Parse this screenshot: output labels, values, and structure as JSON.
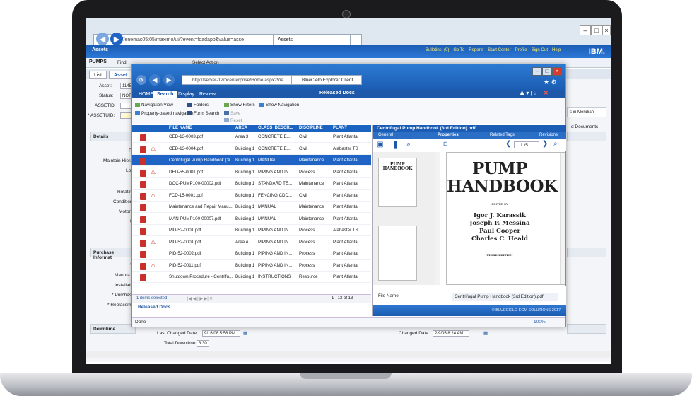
{
  "outer_browser": {
    "url": "http://enemas05:05/maximo/ui/?event=loadapp&value=asse",
    "tab": "Assets",
    "app_label": "Assets",
    "links": [
      "Bulletins: (0)",
      "Go To",
      "Reports",
      "Start Center",
      "Profile",
      "Sign Out",
      "Help"
    ],
    "brand": "IBM."
  },
  "maximo": {
    "record": "PUMPS",
    "find_label": "Find:",
    "select_action": "Select Action",
    "tabs": [
      "List",
      "Asset"
    ],
    "fields": {
      "asset_label": "Asset:",
      "asset_value": "11450",
      "status_label": "Status:",
      "status_value": "NOT R",
      "assetid_label": "ASSETID:",
      "assetuid_label": "* ASSETUID:"
    },
    "sections": [
      "Details",
      "Purchase Informat",
      "Downtime"
    ],
    "detail_labels": [
      "P",
      "Maintain Hiera",
      "Loc",
      "Rotating",
      "Condition",
      "Motor C",
      "U"
    ],
    "purchase_labels": [
      "V",
      "Manufa",
      "Installatio",
      "* Purchase",
      "* Replacemer"
    ],
    "right_labels": [
      "s in Meridian",
      "d Documents"
    ],
    "last_changed_label": "Last Changed Date:",
    "last_changed_value": "9/16/08 5:58 PM",
    "total_downtime_label": "Total Downtime:",
    "total_downtime_value": "3:30",
    "changed_label": "Changed Date:",
    "changed_value": "2/9/05 8:24 AM"
  },
  "inner_browser": {
    "url": "http://server-12/bcenterprise/Home.aspx?Vie",
    "tab": "BlueCielo Explorer Client"
  },
  "ribbon": {
    "tabs": [
      "HOME",
      "Search",
      "Display",
      "Review"
    ],
    "title": "Released Docs",
    "buttons": {
      "navigation_view": "Navigation View",
      "property_nav": "Property-based navigation",
      "folders": "Folders",
      "form_search": "Form Search",
      "show_filters": "Show Filters",
      "save": "Save",
      "reset": "Reset",
      "show_navigation": "Show Navigation"
    }
  },
  "grid": {
    "columns": [
      "FILE NAME",
      "AREA",
      "CLASS_DESCR...",
      "DISCIPLINE",
      "PLANT"
    ],
    "rows": [
      {
        "file": "CED-13-0003.pdf",
        "area": "Area 3",
        "class": "CONCRETE E...",
        "disc": "Civil",
        "plant": "Plant Atlanta"
      },
      {
        "file": "CED-13-0004.pdf",
        "area": "Building 1",
        "class": "CONCRETE E...",
        "disc": "Civil",
        "plant": "Alabaster TS"
      },
      {
        "file": "Centrifugal Pump Handbook (3r...",
        "area": "Building 1",
        "class": "MANUAL",
        "disc": "Maintenance",
        "plant": "Plant Atlanta"
      },
      {
        "file": "DED-55-0001.pdf",
        "area": "Building 1",
        "class": "PIPING AND IN...",
        "disc": "Process",
        "plant": "Plant Atlanta"
      },
      {
        "file": "DOC-PUMP100-00002.pdf",
        "area": "Building 1",
        "class": "STANDARD TE...",
        "disc": "Maintenance",
        "plant": "Plant Atlanta"
      },
      {
        "file": "FCD-15-0001.pdf",
        "area": "Building 1",
        "class": "FENCING CDD...",
        "disc": "Civil",
        "plant": "Plant Atlanta"
      },
      {
        "file": "Maintenance and Repair Manu...",
        "area": "Building 1",
        "class": "MANUAL",
        "disc": "Maintenance",
        "plant": "Plant Atlanta"
      },
      {
        "file": "MAN-PUMP100-00007.pdf",
        "area": "Building 1",
        "class": "MANUAL",
        "disc": "Maintenance",
        "plant": "Plant Atlanta"
      },
      {
        "file": "PID-52-0001.pdf",
        "area": "Building 1",
        "class": "PIPING AND IN...",
        "disc": "Process",
        "plant": "Alabaster TS"
      },
      {
        "file": "PID-52-0001.pdf",
        "area": "Area A",
        "class": "PIPING AND IN...",
        "disc": "Process",
        "plant": "Plant Atlanta"
      },
      {
        "file": "PID-52-0002.pdf",
        "area": "Building 1",
        "class": "PIPING AND IN...",
        "disc": "Process",
        "plant": "Plant Atlanta"
      },
      {
        "file": "PID-52-0011.pdf",
        "area": "Building 1",
        "class": "PIPING AND IN...",
        "disc": "Process",
        "plant": "Plant Atlanta"
      },
      {
        "file": "Shutdown Procedure - Centrifu...",
        "area": "Building 1",
        "class": "INSTRUCTIONS",
        "disc": "Resource",
        "plant": "Plant Atlanta"
      }
    ],
    "selected_index": 2,
    "items_selected": "1 items selected",
    "count": "1 - 13 of 13",
    "released_tab": "Released Docs",
    "status": "Done",
    "zoom": "100%"
  },
  "viewer": {
    "title": "Centrifugal Pump Handbook (3rd Edition).pdf",
    "tabs": [
      "General",
      "Properties",
      "Related Tags",
      "Revisions"
    ],
    "page_value": "1",
    "page_total": "/5",
    "book_title": "PUMP HANDBOOK",
    "edited_by": "EDITED BY",
    "authors": [
      "Igor J. Karassik",
      "Joseph P. Messina",
      "Paul Cooper",
      "Charles C. Heald"
    ],
    "edition": "THIRD EDITION",
    "thumb_number": "1",
    "file_name_label": "File Name",
    "file_name_value": "Centrifugal Pump Handbook (3rd Edition).pdf",
    "copyright": "© BLUECIELO ECM SOLUTIONS 2017"
  },
  "colors": {
    "accent": "#1f64c4",
    "pdf": "#c9302c",
    "lid": "#1b1b1d"
  }
}
